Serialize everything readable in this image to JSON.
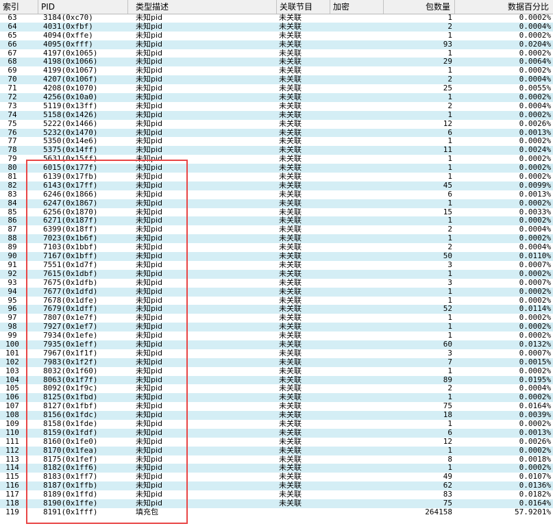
{
  "columns": {
    "index": "索引",
    "pid": "PID",
    "desc": "类型描述",
    "program": "关联节目",
    "encrypt": "加密",
    "count": "包数量",
    "percent": "数据百分比"
  },
  "rows": [
    {
      "index": "63",
      "pid": "3184(0xc70)",
      "desc": "未知pid",
      "program": "未关联",
      "count": "1",
      "percent": "0.0002%"
    },
    {
      "index": "64",
      "pid": "4031(0xfbf)",
      "desc": "未知pid",
      "program": "未关联",
      "count": "2",
      "percent": "0.0004%"
    },
    {
      "index": "65",
      "pid": "4094(0xffe)",
      "desc": "未知pid",
      "program": "未关联",
      "count": "1",
      "percent": "0.0002%"
    },
    {
      "index": "66",
      "pid": "4095(0xfff)",
      "desc": "未知pid",
      "program": "未关联",
      "count": "93",
      "percent": "0.0204%"
    },
    {
      "index": "67",
      "pid": "4197(0x1065)",
      "desc": "未知pid",
      "program": "未关联",
      "count": "1",
      "percent": "0.0002%"
    },
    {
      "index": "68",
      "pid": "4198(0x1066)",
      "desc": "未知pid",
      "program": "未关联",
      "count": "29",
      "percent": "0.0064%"
    },
    {
      "index": "69",
      "pid": "4199(0x1067)",
      "desc": "未知pid",
      "program": "未关联",
      "count": "1",
      "percent": "0.0002%"
    },
    {
      "index": "70",
      "pid": "4207(0x106f)",
      "desc": "未知pid",
      "program": "未关联",
      "count": "2",
      "percent": "0.0004%"
    },
    {
      "index": "71",
      "pid": "4208(0x1070)",
      "desc": "未知pid",
      "program": "未关联",
      "count": "25",
      "percent": "0.0055%"
    },
    {
      "index": "72",
      "pid": "4256(0x10a0)",
      "desc": "未知pid",
      "program": "未关联",
      "count": "1",
      "percent": "0.0002%"
    },
    {
      "index": "73",
      "pid": "5119(0x13ff)",
      "desc": "未知pid",
      "program": "未关联",
      "count": "2",
      "percent": "0.0004%"
    },
    {
      "index": "74",
      "pid": "5158(0x1426)",
      "desc": "未知pid",
      "program": "未关联",
      "count": "1",
      "percent": "0.0002%"
    },
    {
      "index": "75",
      "pid": "5222(0x1466)",
      "desc": "未知pid",
      "program": "未关联",
      "count": "12",
      "percent": "0.0026%"
    },
    {
      "index": "76",
      "pid": "5232(0x1470)",
      "desc": "未知pid",
      "program": "未关联",
      "count": "6",
      "percent": "0.0013%"
    },
    {
      "index": "77",
      "pid": "5350(0x14e6)",
      "desc": "未知pid",
      "program": "未关联",
      "count": "1",
      "percent": "0.0002%"
    },
    {
      "index": "78",
      "pid": "5375(0x14ff)",
      "desc": "未知pid",
      "program": "未关联",
      "count": "11",
      "percent": "0.0024%"
    },
    {
      "index": "79",
      "pid": "5631(0x15ff)",
      "desc": "未知pid",
      "program": "未关联",
      "count": "1",
      "percent": "0.0002%"
    },
    {
      "index": "80",
      "pid": "6015(0x177f)",
      "desc": "未知pid",
      "program": "未关联",
      "count": "1",
      "percent": "0.0002%"
    },
    {
      "index": "81",
      "pid": "6139(0x17fb)",
      "desc": "未知pid",
      "program": "未关联",
      "count": "1",
      "percent": "0.0002%"
    },
    {
      "index": "82",
      "pid": "6143(0x17ff)",
      "desc": "未知pid",
      "program": "未关联",
      "count": "45",
      "percent": "0.0099%"
    },
    {
      "index": "83",
      "pid": "6246(0x1866)",
      "desc": "未知pid",
      "program": "未关联",
      "count": "6",
      "percent": "0.0013%"
    },
    {
      "index": "84",
      "pid": "6247(0x1867)",
      "desc": "未知pid",
      "program": "未关联",
      "count": "1",
      "percent": "0.0002%"
    },
    {
      "index": "85",
      "pid": "6256(0x1870)",
      "desc": "未知pid",
      "program": "未关联",
      "count": "15",
      "percent": "0.0033%"
    },
    {
      "index": "86",
      "pid": "6271(0x187f)",
      "desc": "未知pid",
      "program": "未关联",
      "count": "1",
      "percent": "0.0002%"
    },
    {
      "index": "87",
      "pid": "6399(0x18ff)",
      "desc": "未知pid",
      "program": "未关联",
      "count": "2",
      "percent": "0.0004%"
    },
    {
      "index": "88",
      "pid": "7023(0x1b6f)",
      "desc": "未知pid",
      "program": "未关联",
      "count": "1",
      "percent": "0.0002%"
    },
    {
      "index": "89",
      "pid": "7103(0x1bbf)",
      "desc": "未知pid",
      "program": "未关联",
      "count": "2",
      "percent": "0.0004%"
    },
    {
      "index": "90",
      "pid": "7167(0x1bff)",
      "desc": "未知pid",
      "program": "未关联",
      "count": "50",
      "percent": "0.0110%"
    },
    {
      "index": "91",
      "pid": "7551(0x1d7f)",
      "desc": "未知pid",
      "program": "未关联",
      "count": "3",
      "percent": "0.0007%"
    },
    {
      "index": "92",
      "pid": "7615(0x1dbf)",
      "desc": "未知pid",
      "program": "未关联",
      "count": "1",
      "percent": "0.0002%"
    },
    {
      "index": "93",
      "pid": "7675(0x1dfb)",
      "desc": "未知pid",
      "program": "未关联",
      "count": "3",
      "percent": "0.0007%"
    },
    {
      "index": "94",
      "pid": "7677(0x1dfd)",
      "desc": "未知pid",
      "program": "未关联",
      "count": "1",
      "percent": "0.0002%"
    },
    {
      "index": "95",
      "pid": "7678(0x1dfe)",
      "desc": "未知pid",
      "program": "未关联",
      "count": "1",
      "percent": "0.0002%"
    },
    {
      "index": "96",
      "pid": "7679(0x1dff)",
      "desc": "未知pid",
      "program": "未关联",
      "count": "52",
      "percent": "0.0114%"
    },
    {
      "index": "97",
      "pid": "7807(0x1e7f)",
      "desc": "未知pid",
      "program": "未关联",
      "count": "1",
      "percent": "0.0002%"
    },
    {
      "index": "98",
      "pid": "7927(0x1ef7)",
      "desc": "未知pid",
      "program": "未关联",
      "count": "1",
      "percent": "0.0002%"
    },
    {
      "index": "99",
      "pid": "7934(0x1efe)",
      "desc": "未知pid",
      "program": "未关联",
      "count": "1",
      "percent": "0.0002%"
    },
    {
      "index": "100",
      "pid": "7935(0x1eff)",
      "desc": "未知pid",
      "program": "未关联",
      "count": "60",
      "percent": "0.0132%"
    },
    {
      "index": "101",
      "pid": "7967(0x1f1f)",
      "desc": "未知pid",
      "program": "未关联",
      "count": "3",
      "percent": "0.0007%"
    },
    {
      "index": "102",
      "pid": "7983(0x1f2f)",
      "desc": "未知pid",
      "program": "未关联",
      "count": "7",
      "percent": "0.0015%"
    },
    {
      "index": "103",
      "pid": "8032(0x1f60)",
      "desc": "未知pid",
      "program": "未关联",
      "count": "1",
      "percent": "0.0002%"
    },
    {
      "index": "104",
      "pid": "8063(0x1f7f)",
      "desc": "未知pid",
      "program": "未关联",
      "count": "89",
      "percent": "0.0195%"
    },
    {
      "index": "105",
      "pid": "8092(0x1f9c)",
      "desc": "未知pid",
      "program": "未关联",
      "count": "2",
      "percent": "0.0004%"
    },
    {
      "index": "106",
      "pid": "8125(0x1fbd)",
      "desc": "未知pid",
      "program": "未关联",
      "count": "1",
      "percent": "0.0002%"
    },
    {
      "index": "107",
      "pid": "8127(0x1fbf)",
      "desc": "未知pid",
      "program": "未关联",
      "count": "75",
      "percent": "0.0164%"
    },
    {
      "index": "108",
      "pid": "8156(0x1fdc)",
      "desc": "未知pid",
      "program": "未关联",
      "count": "18",
      "percent": "0.0039%"
    },
    {
      "index": "109",
      "pid": "8158(0x1fde)",
      "desc": "未知pid",
      "program": "未关联",
      "count": "1",
      "percent": "0.0002%"
    },
    {
      "index": "110",
      "pid": "8159(0x1fdf)",
      "desc": "未知pid",
      "program": "未关联",
      "count": "6",
      "percent": "0.0013%"
    },
    {
      "index": "111",
      "pid": "8160(0x1fe0)",
      "desc": "未知pid",
      "program": "未关联",
      "count": "12",
      "percent": "0.0026%"
    },
    {
      "index": "112",
      "pid": "8170(0x1fea)",
      "desc": "未知pid",
      "program": "未关联",
      "count": "1",
      "percent": "0.0002%"
    },
    {
      "index": "113",
      "pid": "8175(0x1fef)",
      "desc": "未知pid",
      "program": "未关联",
      "count": "8",
      "percent": "0.0018%"
    },
    {
      "index": "114",
      "pid": "8182(0x1ff6)",
      "desc": "未知pid",
      "program": "未关联",
      "count": "1",
      "percent": "0.0002%"
    },
    {
      "index": "115",
      "pid": "8183(0x1ff7)",
      "desc": "未知pid",
      "program": "未关联",
      "count": "49",
      "percent": "0.0107%"
    },
    {
      "index": "116",
      "pid": "8187(0x1ffb)",
      "desc": "未知pid",
      "program": "未关联",
      "count": "62",
      "percent": "0.0136%"
    },
    {
      "index": "117",
      "pid": "8189(0x1ffd)",
      "desc": "未知pid",
      "program": "未关联",
      "count": "83",
      "percent": "0.0182%"
    },
    {
      "index": "118",
      "pid": "8190(0x1ffe)",
      "desc": "未知pid",
      "program": "未关联",
      "count": "75",
      "percent": "0.0164%"
    },
    {
      "index": "119",
      "pid": "8191(0x1fff)",
      "desc": "填充包",
      "program": "",
      "count": "264158",
      "percent": "57.9201%"
    }
  ],
  "colors": {
    "row_alt": "#d4eef5",
    "header_bg": "#f0f0f0",
    "highlight_border": "#e84545"
  }
}
